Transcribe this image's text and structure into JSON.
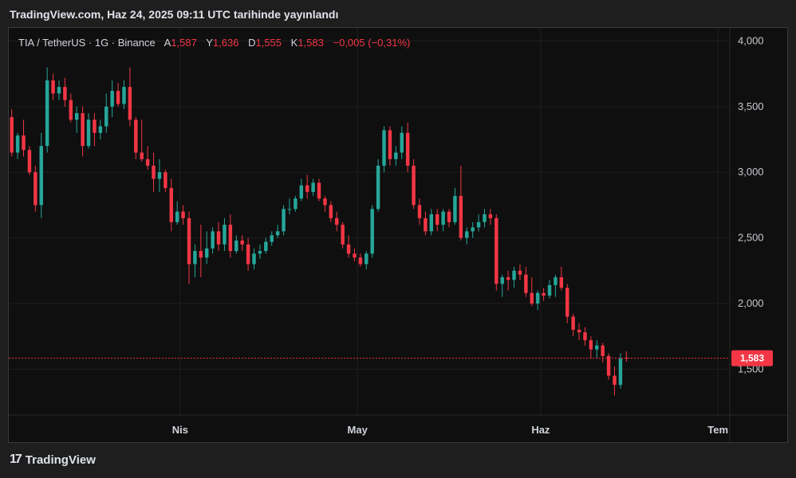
{
  "header": {
    "publish_line": "TradingView.com, Haz 24, 2025 09:11 UTC tarihinde yayınlandı"
  },
  "footer": {
    "brand": "TradingView",
    "logo_glyph": "17"
  },
  "legend": {
    "symbol": "TIA / TetherUS · 1G · Binance",
    "o_label": "A",
    "o_value": "1,587",
    "h_label": "Y",
    "h_value": "1,636",
    "l_label": "D",
    "l_value": "1,555",
    "c_label": "K",
    "c_value": "1,583",
    "change": "−0,005 (−0,31%)"
  },
  "colors": {
    "up": "#26a69a",
    "down": "#f23645",
    "price_line": "#f23645",
    "background": "#0f0f0f"
  },
  "chart_data": {
    "type": "candlestick",
    "title": "TIA / TetherUS · 1G · Binance",
    "ylim": [
      1.15,
      4.1
    ],
    "y_ticks": [
      {
        "v": 4.0,
        "label": "4,000"
      },
      {
        "v": 3.5,
        "label": "3,500"
      },
      {
        "v": 3.0,
        "label": "3,000"
      },
      {
        "v": 2.5,
        "label": "2,500"
      },
      {
        "v": 2.0,
        "label": "2,000"
      },
      {
        "v": 1.5,
        "label": "1,500"
      }
    ],
    "x_range": [
      "2025-03-03",
      "2025-07-03"
    ],
    "x_ticks": [
      {
        "date": "2025-04-01",
        "label": "Nis"
      },
      {
        "date": "2025-05-01",
        "label": "May"
      },
      {
        "date": "2025-06-01",
        "label": "Haz"
      },
      {
        "date": "2025-07-01",
        "label": "Tem"
      }
    ],
    "last_price": 1.583,
    "last_price_label": "1,583",
    "grid": true,
    "candles": [
      [
        3.42,
        3.48,
        3.12,
        3.15
      ],
      [
        3.15,
        3.3,
        3.1,
        3.28
      ],
      [
        3.28,
        3.4,
        3.12,
        3.17
      ],
      [
        3.17,
        3.2,
        2.98,
        3.0
      ],
      [
        3.0,
        3.05,
        2.7,
        2.75
      ],
      [
        2.75,
        3.3,
        2.65,
        3.2
      ],
      [
        3.2,
        3.8,
        3.15,
        3.7
      ],
      [
        3.7,
        3.75,
        3.55,
        3.6
      ],
      [
        3.6,
        3.7,
        3.55,
        3.65
      ],
      [
        3.65,
        3.72,
        3.5,
        3.55
      ],
      [
        3.55,
        3.6,
        3.38,
        3.4
      ],
      [
        3.4,
        3.5,
        3.3,
        3.45
      ],
      [
        3.45,
        3.5,
        3.12,
        3.2
      ],
      [
        3.2,
        3.45,
        3.18,
        3.4
      ],
      [
        3.4,
        3.45,
        3.2,
        3.3
      ],
      [
        3.3,
        3.4,
        3.25,
        3.35
      ],
      [
        3.35,
        3.6,
        3.3,
        3.5
      ],
      [
        3.5,
        3.7,
        3.42,
        3.62
      ],
      [
        3.62,
        3.68,
        3.5,
        3.52
      ],
      [
        3.52,
        3.7,
        3.48,
        3.65
      ],
      [
        3.65,
        3.8,
        3.35,
        3.4
      ],
      [
        3.4,
        3.42,
        3.1,
        3.15
      ],
      [
        3.15,
        3.4,
        3.08,
        3.1
      ],
      [
        3.1,
        3.2,
        3.02,
        3.05
      ],
      [
        3.05,
        3.15,
        2.85,
        2.95
      ],
      [
        2.95,
        3.1,
        2.85,
        3.0
      ],
      [
        3.0,
        3.02,
        2.85,
        2.88
      ],
      [
        2.88,
        2.95,
        2.55,
        2.62
      ],
      [
        2.62,
        2.78,
        2.6,
        2.7
      ],
      [
        2.7,
        2.75,
        2.6,
        2.65
      ],
      [
        2.65,
        2.7,
        2.15,
        2.3
      ],
      [
        2.3,
        2.45,
        2.2,
        2.4
      ],
      [
        2.4,
        2.6,
        2.2,
        2.35
      ],
      [
        2.35,
        2.55,
        2.3,
        2.42
      ],
      [
        2.42,
        2.58,
        2.38,
        2.55
      ],
      [
        2.55,
        2.62,
        2.4,
        2.45
      ],
      [
        2.45,
        2.65,
        2.4,
        2.6
      ],
      [
        2.6,
        2.68,
        2.35,
        2.4
      ],
      [
        2.4,
        2.52,
        2.38,
        2.48
      ],
      [
        2.48,
        2.52,
        2.4,
        2.45
      ],
      [
        2.45,
        2.5,
        2.25,
        2.3
      ],
      [
        2.3,
        2.42,
        2.26,
        2.38
      ],
      [
        2.38,
        2.45,
        2.34,
        2.4
      ],
      [
        2.4,
        2.5,
        2.38,
        2.47
      ],
      [
        2.47,
        2.55,
        2.44,
        2.52
      ],
      [
        2.52,
        2.6,
        2.5,
        2.55
      ],
      [
        2.55,
        2.75,
        2.52,
        2.72
      ],
      [
        2.72,
        2.8,
        2.68,
        2.72
      ],
      [
        2.72,
        2.82,
        2.7,
        2.8
      ],
      [
        2.8,
        2.95,
        2.78,
        2.9
      ],
      [
        2.9,
        2.98,
        2.8,
        2.85
      ],
      [
        2.85,
        2.95,
        2.82,
        2.92
      ],
      [
        2.92,
        2.95,
        2.78,
        2.8
      ],
      [
        2.8,
        2.82,
        2.7,
        2.75
      ],
      [
        2.75,
        2.78,
        2.62,
        2.65
      ],
      [
        2.65,
        2.7,
        2.55,
        2.6
      ],
      [
        2.6,
        2.62,
        2.42,
        2.45
      ],
      [
        2.45,
        2.52,
        2.35,
        2.38
      ],
      [
        2.38,
        2.42,
        2.32,
        2.35
      ],
      [
        2.35,
        2.38,
        2.28,
        2.3
      ],
      [
        2.3,
        2.4,
        2.26,
        2.38
      ],
      [
        2.38,
        2.75,
        2.35,
        2.72
      ],
      [
        2.72,
        3.1,
        2.7,
        3.05
      ],
      [
        3.05,
        3.35,
        3.0,
        3.32
      ],
      [
        3.32,
        3.35,
        3.05,
        3.1
      ],
      [
        3.1,
        3.2,
        3.05,
        3.15
      ],
      [
        3.15,
        3.35,
        3.1,
        3.3
      ],
      [
        3.3,
        3.38,
        3.0,
        3.05
      ],
      [
        3.05,
        3.1,
        2.72,
        2.75
      ],
      [
        2.75,
        2.8,
        2.6,
        2.65
      ],
      [
        2.65,
        2.7,
        2.52,
        2.55
      ],
      [
        2.55,
        2.72,
        2.52,
        2.68
      ],
      [
        2.68,
        2.72,
        2.55,
        2.6
      ],
      [
        2.6,
        2.72,
        2.55,
        2.7
      ],
      [
        2.7,
        2.72,
        2.58,
        2.62
      ],
      [
        2.62,
        2.88,
        2.6,
        2.82
      ],
      [
        2.82,
        3.05,
        2.48,
        2.5
      ],
      [
        2.5,
        2.58,
        2.45,
        2.55
      ],
      [
        2.55,
        2.62,
        2.5,
        2.58
      ],
      [
        2.58,
        2.68,
        2.55,
        2.62
      ],
      [
        2.62,
        2.72,
        2.58,
        2.68
      ],
      [
        2.68,
        2.72,
        2.6,
        2.65
      ],
      [
        2.65,
        2.68,
        2.1,
        2.15
      ],
      [
        2.15,
        2.22,
        2.05,
        2.2
      ],
      [
        2.2,
        2.25,
        2.1,
        2.18
      ],
      [
        2.18,
        2.28,
        2.12,
        2.25
      ],
      [
        2.25,
        2.3,
        2.18,
        2.22
      ],
      [
        2.22,
        2.28,
        2.05,
        2.08
      ],
      [
        2.08,
        2.2,
        1.98,
        2.0
      ],
      [
        2.0,
        2.1,
        1.95,
        2.08
      ],
      [
        2.08,
        2.12,
        2.02,
        2.06
      ],
      [
        2.06,
        2.18,
        2.04,
        2.14
      ],
      [
        2.14,
        2.22,
        2.05,
        2.2
      ],
      [
        2.2,
        2.28,
        2.1,
        2.12
      ],
      [
        2.12,
        2.15,
        1.85,
        1.9
      ],
      [
        1.9,
        1.92,
        1.75,
        1.8
      ],
      [
        1.8,
        1.85,
        1.72,
        1.78
      ],
      [
        1.78,
        1.82,
        1.68,
        1.72
      ],
      [
        1.72,
        1.75,
        1.58,
        1.65
      ],
      [
        1.65,
        1.72,
        1.58,
        1.68
      ],
      [
        1.68,
        1.7,
        1.55,
        1.6
      ],
      [
        1.6,
        1.62,
        1.42,
        1.45
      ],
      [
        1.45,
        1.52,
        1.3,
        1.38
      ],
      [
        1.38,
        1.62,
        1.35,
        1.58
      ],
      [
        1.587,
        1.636,
        1.555,
        1.583
      ]
    ]
  }
}
